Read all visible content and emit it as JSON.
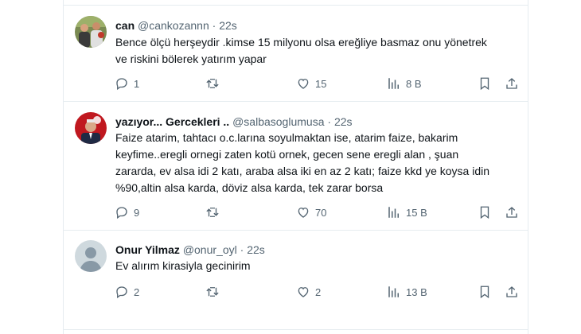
{
  "tweets": [
    {
      "name": "can",
      "handle": "@cankozannn",
      "dot": "·",
      "time": "22s",
      "text": [
        "Bence ölçü herşeydir .kimse 15 milyonu olsa ereğliye basmaz onu yönetrek",
        "ve riskini bölerek yatırım yapar"
      ],
      "replies": "1",
      "retweets": "",
      "likes": "15",
      "views": "8 B"
    },
    {
      "name": "yazıyor... Gercekleri ..",
      "handle": "@salbasoglumusa",
      "dot": "·",
      "time": "22s",
      "text": [
        "Faize atarim, tahtacı o.c.larına soyulmaktan ise, atarim faize, bakarim",
        "keyfime..eregli ornegi zaten kotü ornek, gecen sene eregli alan , şuan",
        "zararda, ev alsa idi 2 katı, araba alsa iki en az 2 katı; faize kkd ye koysa idin",
        "%90,altin alsa karda, döviz alsa karda, tek zarar borsa"
      ],
      "replies": "9",
      "retweets": "",
      "likes": "70",
      "views": "15 B"
    },
    {
      "name": "Onur Yilmaz",
      "handle": "@onur_oyl",
      "dot": "·",
      "time": "22s",
      "text": [
        "Ev alırım kirasiyla gecinirim"
      ],
      "replies": "2",
      "retweets": "",
      "likes": "2",
      "views": "13 B"
    }
  ],
  "icons": {
    "reply": "reply-icon",
    "retweet": "retweet-icon",
    "like": "heart-icon",
    "views": "views-icon",
    "bookmark": "bookmark-icon",
    "share": "share-icon"
  },
  "colors": {
    "text": "#0f1419",
    "secondary": "#536471",
    "border": "#e6ecf0",
    "default_avatar": "#cfd9de"
  }
}
